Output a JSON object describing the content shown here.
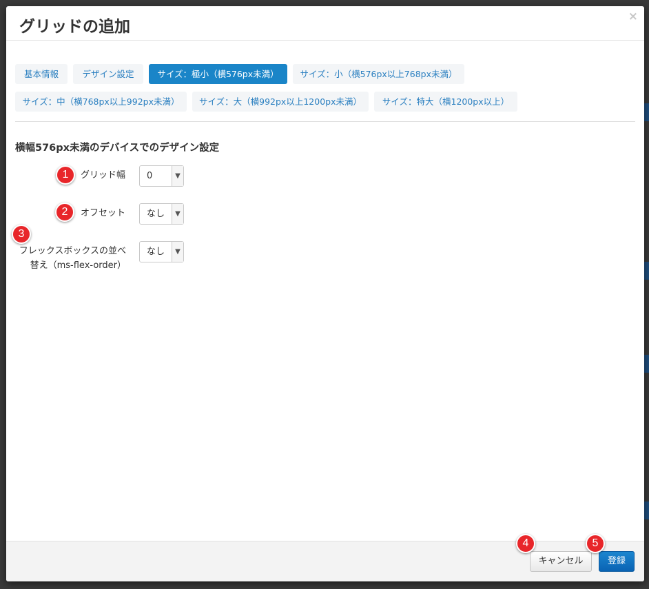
{
  "modal": {
    "title": "グリッドの追加",
    "close": "×"
  },
  "tabs": [
    {
      "label": "基本情報",
      "active": false
    },
    {
      "label": "デザイン設定",
      "active": false
    },
    {
      "label": "サイズ：極小（横576px未満）",
      "active": true
    },
    {
      "label": "サイズ：小（横576px以上768px未満）",
      "active": false
    },
    {
      "label": "サイズ：中（横768px以上992px未満）",
      "active": false
    },
    {
      "label": "サイズ：大（横992px以上1200px未満）",
      "active": false
    },
    {
      "label": "サイズ：特大（横1200px以上）",
      "active": false
    }
  ],
  "section": {
    "title": "横幅576px未満のデバイスでのデザイン設定"
  },
  "fields": {
    "grid_width": {
      "label": "グリッド幅",
      "value": "0"
    },
    "offset": {
      "label": "オフセット",
      "value": "なし"
    },
    "flex_order": {
      "label_line1": "フレックスボックスの並べ",
      "label_line2": "替え（ms-flex-order）",
      "value": "なし"
    }
  },
  "badges": [
    "1",
    "2",
    "3",
    "4",
    "5"
  ],
  "footer": {
    "cancel_label": "キャンセル",
    "submit_label": "登録"
  },
  "colors": {
    "accent": "#1a85c8",
    "tab_text": "#2a7fc0",
    "badge": "#e8262a",
    "submit": "#0a63b4"
  }
}
